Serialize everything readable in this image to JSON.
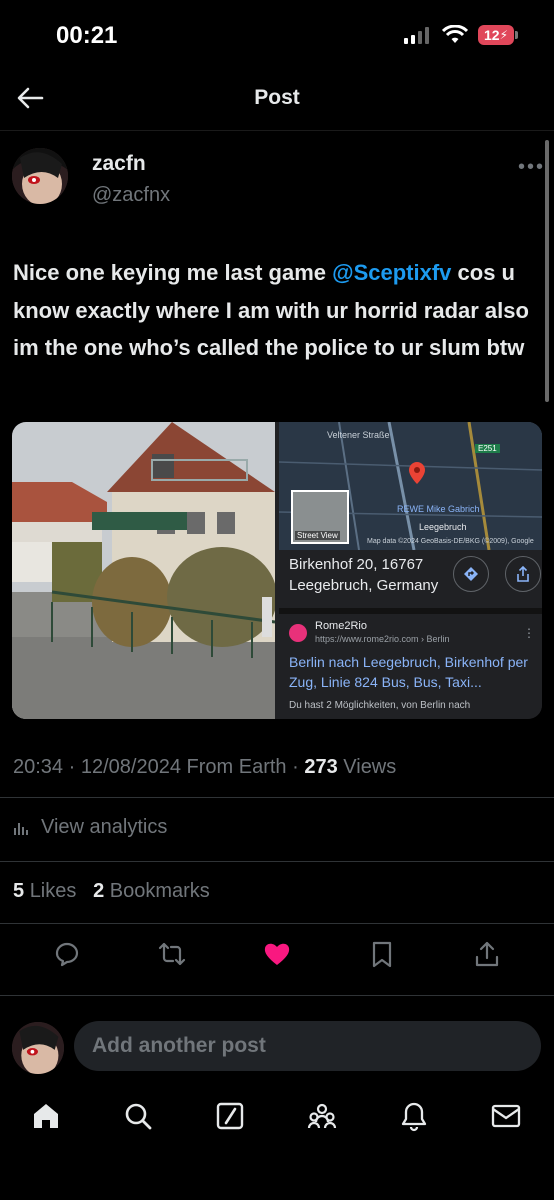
{
  "status_bar": {
    "time": "00:21",
    "battery": "12"
  },
  "header": {
    "title": "Post"
  },
  "author": {
    "name": "zacfn",
    "handle": "@zacfnx"
  },
  "post": {
    "text_before": "Nice one keying me last game ",
    "mention": "@Sceptixfv",
    "text_after": " cos u know exactly where I am with ur horrid radar also im the one who’s called the police to ur slum btw"
  },
  "media": {
    "map_labels": {
      "street": "Veltener Straße",
      "road_badge": "E251",
      "poi": "REWE Mike Gabrich",
      "town": "Leegebruch",
      "street_view": "Street View",
      "map_data": "Map data ©2024 GeoBasis-DE/BKG (©2009), Google"
    },
    "address_line1": "Birkenhof 20, 16767",
    "address_line2": "Leegebruch, Germany",
    "result": {
      "site_name": "Rome2Rio",
      "url": "https://www.rome2rio.com › Berlin",
      "title": "Berlin nach Leegebruch, Birkenhof per Zug, Linie 824 Bus, Bus, Taxi...",
      "snippet": "Du hast 2 Möglichkeiten, von Berlin nach"
    }
  },
  "meta": {
    "time": "20:34",
    "date": "12/08/2024",
    "source": "From Earth",
    "views_count": "273",
    "views_label": "Views"
  },
  "analytics_label": "View analytics",
  "counts": {
    "likes_count": "5",
    "likes_label": "Likes",
    "bookmarks_count": "2",
    "bookmarks_label": "Bookmarks"
  },
  "reply": {
    "placeholder": "Add another post"
  },
  "colors": {
    "accent": "#1d9bf0",
    "like": "#f91880",
    "background": "#000000"
  },
  "icons": {
    "actions": [
      "reply-icon",
      "repost-icon",
      "like-icon-filled",
      "bookmark-icon",
      "share-icon"
    ],
    "tabs": [
      "home-icon",
      "search-icon",
      "grok-icon",
      "communities-icon",
      "notifications-icon",
      "messages-icon"
    ]
  }
}
